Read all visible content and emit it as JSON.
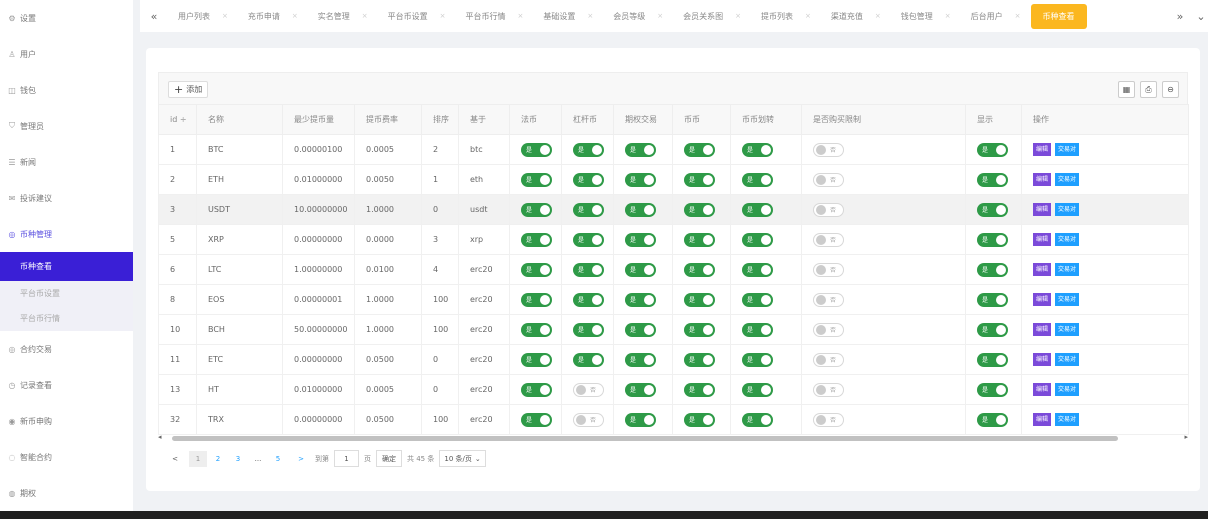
{
  "sidebar": {
    "items": [
      {
        "icon": "gear-icon",
        "glyph": "⚙",
        "label": "设置"
      },
      {
        "icon": "user-icon",
        "glyph": "♙",
        "label": "用户"
      },
      {
        "icon": "wallet-icon",
        "glyph": "◫",
        "label": "钱包"
      },
      {
        "icon": "admin-icon",
        "glyph": "⛉",
        "label": "管理员"
      },
      {
        "icon": "news-icon",
        "glyph": "☰",
        "label": "新闻"
      },
      {
        "icon": "feedback-icon",
        "glyph": "✉",
        "label": "投诉建议"
      }
    ],
    "currency": {
      "icon": "coin-icon",
      "glyph": "◎",
      "label": "币种管理"
    },
    "submenu": [
      "币种查看",
      "平台币设置",
      "平台币行情"
    ],
    "bottom_items": [
      {
        "icon": "contract-icon",
        "glyph": "◎",
        "label": "合约交易"
      },
      {
        "icon": "record-icon",
        "glyph": "◷",
        "label": "记录查看"
      },
      {
        "icon": "new-coin-icon",
        "glyph": "◉",
        "label": "新币申购"
      },
      {
        "icon": "robot-icon",
        "glyph": "◌",
        "label": "智能合约"
      },
      {
        "icon": "option-icon",
        "glyph": "◍",
        "label": "期权"
      }
    ]
  },
  "tabs": {
    "prev_glyph": "«",
    "next_glyph": "»",
    "more_glyph": "⌄",
    "close_glyph": "×",
    "items": [
      "用户列表",
      "充币申请",
      "实名管理",
      "平台币设置",
      "平台币行情",
      "基础设置",
      "会员等级",
      "会员关系图",
      "提币列表",
      "渠道充值",
      "钱包管理",
      "后台用户"
    ],
    "active": "币种查看"
  },
  "toolbar": {
    "add_label": "添加",
    "add_glyph": "+",
    "tools": [
      {
        "name": "columns-icon",
        "glyph": "▦"
      },
      {
        "name": "print-icon",
        "glyph": "⎙"
      },
      {
        "name": "export-icon",
        "glyph": "⊖"
      }
    ]
  },
  "table": {
    "columns": [
      "id ÷",
      "名称",
      "最少提币量",
      "提币费率",
      "排序",
      "基于",
      "法币",
      "杠杆币",
      "期权交易",
      "币币",
      "币币划转",
      "是否购买限制",
      "显示",
      "操作"
    ],
    "on_label": "是",
    "off_label": "否",
    "edit_label": "编辑",
    "pair_label": "交易对",
    "rows": [
      {
        "id": "1",
        "name": "BTC",
        "min": "0.00000100",
        "rate": "0.0005",
        "sort": "2",
        "base": "btc",
        "fiat": true,
        "lever": true,
        "option": true,
        "spot": true,
        "transfer": true,
        "limit": false,
        "show": true
      },
      {
        "id": "2",
        "name": "ETH",
        "min": "0.01000000",
        "rate": "0.0050",
        "sort": "1",
        "base": "eth",
        "fiat": true,
        "lever": true,
        "option": true,
        "spot": true,
        "transfer": true,
        "limit": false,
        "show": true
      },
      {
        "id": "3",
        "name": "USDT",
        "min": "10.00000000",
        "rate": "1.0000",
        "sort": "0",
        "base": "usdt",
        "fiat": true,
        "lever": true,
        "option": true,
        "spot": true,
        "transfer": true,
        "limit": false,
        "show": true
      },
      {
        "id": "5",
        "name": "XRP",
        "min": "0.00000000",
        "rate": "0.0000",
        "sort": "3",
        "base": "xrp",
        "fiat": true,
        "lever": true,
        "option": true,
        "spot": true,
        "transfer": true,
        "limit": false,
        "show": true
      },
      {
        "id": "6",
        "name": "LTC",
        "min": "1.00000000",
        "rate": "0.0100",
        "sort": "4",
        "base": "erc20",
        "fiat": true,
        "lever": true,
        "option": true,
        "spot": true,
        "transfer": true,
        "limit": false,
        "show": true
      },
      {
        "id": "8",
        "name": "EOS",
        "min": "0.00000001",
        "rate": "1.0000",
        "sort": "100",
        "base": "erc20",
        "fiat": true,
        "lever": true,
        "option": true,
        "spot": true,
        "transfer": true,
        "limit": false,
        "show": true
      },
      {
        "id": "10",
        "name": "BCH",
        "min": "50.00000000",
        "rate": "1.0000",
        "sort": "100",
        "base": "erc20",
        "fiat": true,
        "lever": true,
        "option": true,
        "spot": true,
        "transfer": true,
        "limit": false,
        "show": true
      },
      {
        "id": "11",
        "name": "ETC",
        "min": "0.00000000",
        "rate": "0.0500",
        "sort": "0",
        "base": "erc20",
        "fiat": true,
        "lever": true,
        "option": true,
        "spot": true,
        "transfer": true,
        "limit": false,
        "show": true
      },
      {
        "id": "13",
        "name": "HT",
        "min": "0.01000000",
        "rate": "0.0005",
        "sort": "0",
        "base": "erc20",
        "fiat": true,
        "lever": false,
        "option": true,
        "spot": true,
        "transfer": true,
        "limit": false,
        "show": true
      },
      {
        "id": "32",
        "name": "TRX",
        "min": "0.00000000",
        "rate": "0.0500",
        "sort": "100",
        "base": "erc20",
        "fiat": true,
        "lever": false,
        "option": true,
        "spot": true,
        "transfer": true,
        "limit": false,
        "show": true
      }
    ]
  },
  "pager": {
    "prev": "<",
    "pages": [
      "1",
      "2",
      "3",
      "...",
      "5"
    ],
    "next": ">",
    "goto_label": "到第",
    "goto_value": "1",
    "page_unit": "页",
    "confirm": "确定",
    "total": "共 45 条",
    "per_page": "10 条/页",
    "per_page_arrow": "⌄"
  },
  "colors": {
    "accent": "#3a1fd6",
    "active_tab": "#fbb71f",
    "switch_on": "#2e9a47",
    "edit": "#7b4ad9",
    "pair": "#1e9fff"
  }
}
